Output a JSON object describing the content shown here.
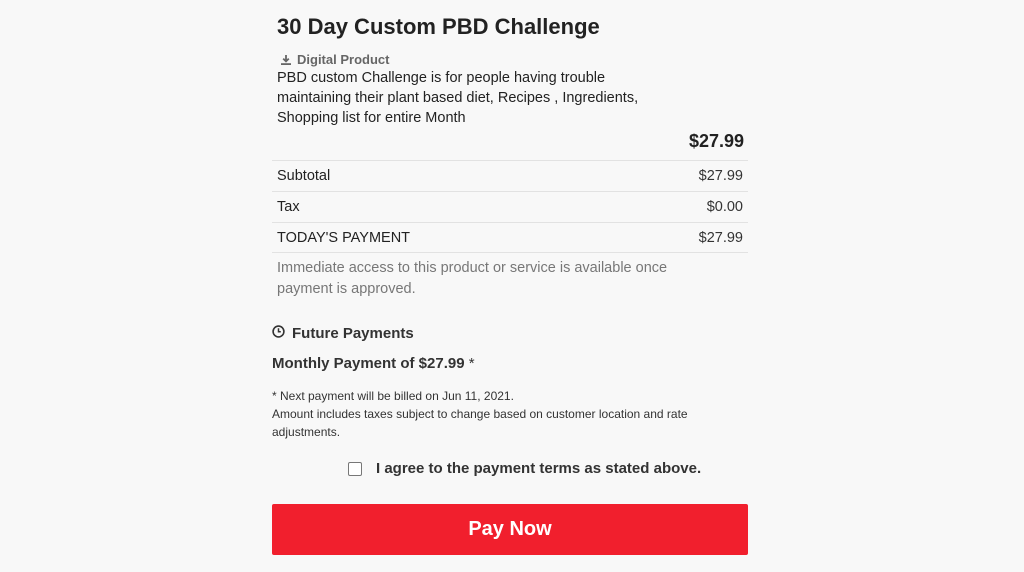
{
  "product": {
    "title": "30 Day Custom PBD Challenge",
    "type_icon": "download-icon",
    "type_label": "Digital Product",
    "description": "PBD custom Challenge is for people having trouble maintaining their plant based diet, Recipes , Ingredients, Shopping list for entire Month",
    "price": "$27.99"
  },
  "summary": {
    "subtotal_label": "Subtotal",
    "subtotal_value": "$27.99",
    "tax_label": "Tax",
    "tax_value": "$0.00",
    "today_label": "TODAY'S PAYMENT",
    "today_value": "$27.99"
  },
  "access_note": "Immediate access to this product or service is available once payment is approved.",
  "future": {
    "icon": "clock-icon",
    "heading": "Future Payments",
    "monthly_label": "Monthly Payment of $27.99",
    "monthly_star": " *",
    "next_payment_note": "* Next payment will be billed on Jun 11, 2021.",
    "tax_note": "Amount includes taxes subject to change based on customer location and rate adjustments."
  },
  "terms": {
    "checked": false,
    "label": "I agree to the payment terms as stated above."
  },
  "pay_button": {
    "label": "Pay Now",
    "color": "#f11f2d"
  }
}
